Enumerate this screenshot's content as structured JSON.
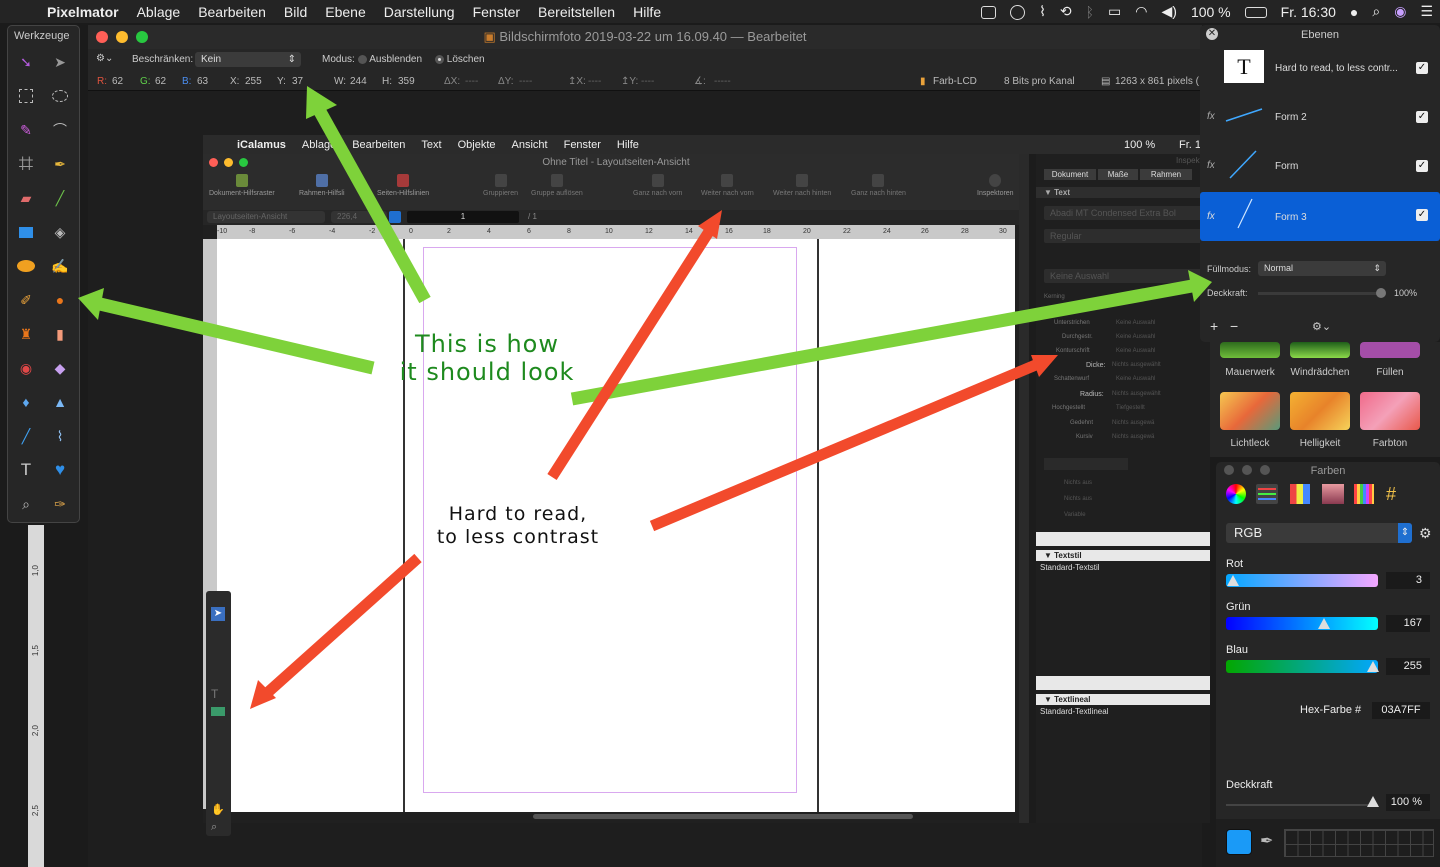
{
  "menubar": {
    "app": "Pixelmator",
    "items": [
      "Ablage",
      "Bearbeiten",
      "Bild",
      "Ebene",
      "Darstellung",
      "Fenster",
      "Bereitstellen",
      "Hilfe"
    ],
    "battery": "100 %",
    "clock": "Fr. 16:30"
  },
  "window": {
    "title": "Bildschirmfoto 2019-03-22 um 16.09.40",
    "status": "— Bearbeitet"
  },
  "options": {
    "constrain_label": "Beschränken:",
    "constrain_value": "Kein",
    "mode_label": "Modus:",
    "mode_hide": "Ausblenden",
    "mode_delete": "Löschen"
  },
  "info": {
    "r_label": "R:",
    "r": "62",
    "g_label": "G:",
    "g": "62",
    "b_label": "B:",
    "b": "63",
    "x_label": "X:",
    "x": "255",
    "y_label": "Y:",
    "y": "37",
    "w_label": "W:",
    "w": "244",
    "h_label": "H:",
    "h": "359",
    "dx_label": "ΔX:",
    "dx": "----",
    "dy_label": "ΔY:",
    "dy": "----",
    "ix_label": "↥X:",
    "ix": "----",
    "iy_label": "↥Y:",
    "iy": "----",
    "angle_label": "∡:",
    "angle": "-----",
    "profile": "Farb-LCD",
    "bits": "8 Bits pro Kanal",
    "size": "1263 x 861 pixels ("
  },
  "tools": {
    "title": "Werkzeuge"
  },
  "ical": {
    "app": "iCalamus",
    "menu": [
      "Ablage",
      "Bearbeiten",
      "Text",
      "Objekte",
      "Ansicht",
      "Fenster",
      "Hilfe"
    ],
    "battery": "100 %",
    "clock": "Fr. 1",
    "window_title": "Ohne Titel - Layoutseiten-Ansicht",
    "toolbar": [
      "Dokument-Hilfsraster",
      "Rahmen-Hilfsli",
      "Seiten-Hilfslinien",
      "Gruppieren",
      "Gruppe auflösen",
      "Ganz nach vorn",
      "Weiter nach vorn",
      "Weiter nach hinten",
      "Ganz nach hinten",
      "Inspektoren"
    ],
    "view_select": "Layoutseiten-Ansicht",
    "zoom": "226,4",
    "page_num": "1",
    "page_total": "/ 1",
    "ruler_h": [
      "-10",
      "-8",
      "-6",
      "-4",
      "-2",
      "0",
      "2",
      "4",
      "6",
      "8",
      "10",
      "12",
      "14",
      "16",
      "18",
      "20",
      "22",
      "24",
      "26",
      "28",
      "30"
    ],
    "ruler_v": [
      "1,0",
      "1,5",
      "2,0",
      "2,5"
    ],
    "inspector": {
      "title": "Inspekt",
      "tabs": [
        "Dokument",
        "Maße",
        "Rahmen"
      ],
      "sec_text": "Text",
      "font": "Abadi MT Condensed Extra Bol",
      "style": "Regular",
      "no_selection": "Keine Auswahl",
      "kerning": "Kerning",
      "rows": [
        "Unterstrichen",
        "Durchgestr.",
        "Konturschrift",
        "Dicke:",
        "Schattenwurf",
        "Radius:",
        "Hochgestellt",
        "Gedehnt",
        "Kursiv"
      ],
      "row_values": [
        "Keine Auswahl",
        "Keine Auswahl",
        "Keine Auswahl",
        "Nichts ausgewählt",
        "Keine Auswahl",
        "Nichts ausgewählt",
        "Tiefgestellt",
        "Nichts ausgewä",
        "Nichts ausgewä"
      ],
      "mini": [
        "Nichts aus",
        "Nichts aus",
        "Variable"
      ],
      "sec_textstil": "Textstil",
      "textstil_value": "Standard-Textstil",
      "sec_textlineal": "Textlineal",
      "textlineal_value": "Standard-Textlineal"
    }
  },
  "layers": {
    "title": "Ebenen",
    "items": [
      {
        "name": "Hard to read, to less contr...",
        "kind": "T"
      },
      {
        "name": "Form 2",
        "kind": "fx"
      },
      {
        "name": "Form",
        "kind": "fx"
      },
      {
        "name": "Form 3",
        "kind": "fx"
      }
    ],
    "blend_label": "Füllmodus:",
    "blend_value": "Normal",
    "opacity_label": "Deckkraft:",
    "opacity_value": "100%",
    "add": "+",
    "remove": "−",
    "settings": "⚙⌄"
  },
  "brushes": {
    "row1": [
      "Mauerwerk",
      "Windrädchen",
      "Füllen"
    ],
    "row2": [
      "Lichtleck",
      "Helligkeit",
      "Farbton"
    ]
  },
  "colors": {
    "title": "Farben",
    "model": "RGB",
    "red_label": "Rot",
    "red": 3,
    "green_label": "Grün",
    "green": 167,
    "blue_label": "Blau",
    "blue": 255,
    "hex_label": "Hex-Farbe #",
    "hex": "03A7FF",
    "opacity_label": "Deckkraft",
    "opacity": "100 %",
    "swatch_color": "#1a9af7"
  },
  "annotations": {
    "good": [
      "This is how",
      "it should look"
    ],
    "bad": [
      "Hard to read,",
      "to less contrast"
    ],
    "good_color": "#7ed23a",
    "bad_color": "#f24a2c"
  }
}
